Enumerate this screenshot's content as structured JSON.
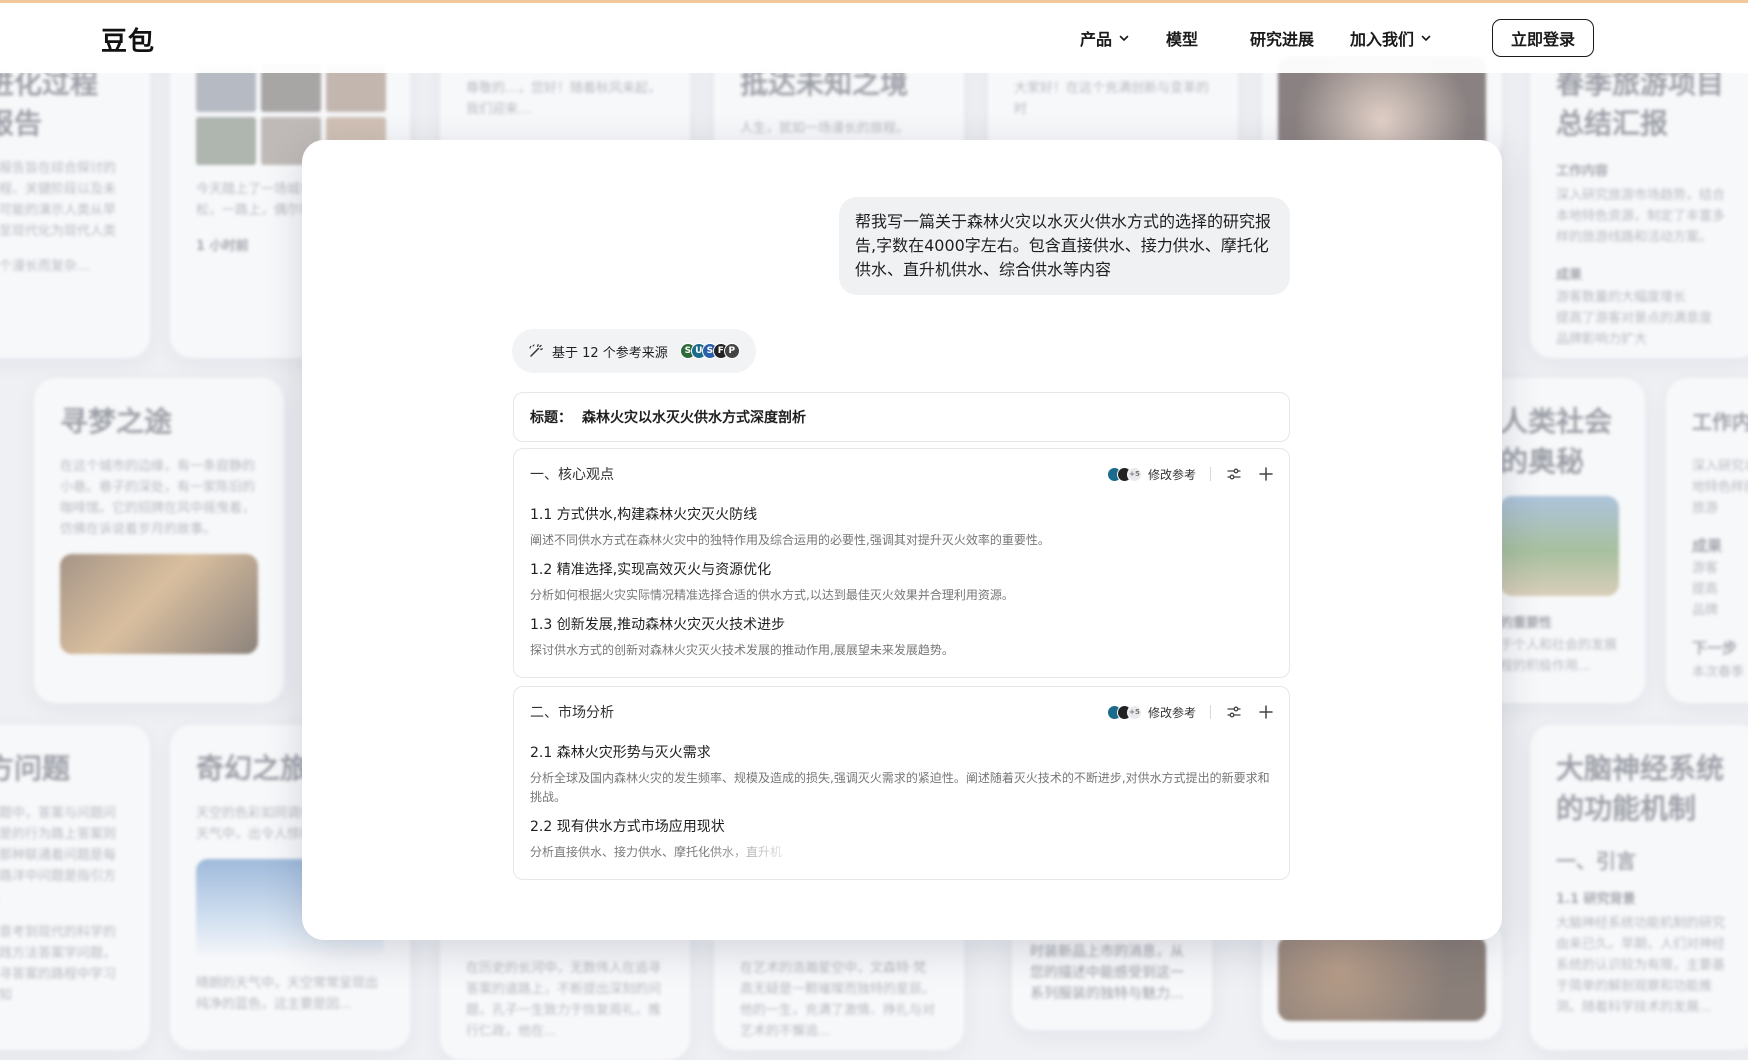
{
  "header": {
    "logo": "豆包",
    "nav": [
      {
        "label": "产品",
        "has_dropdown": true
      },
      {
        "label": "模型",
        "has_dropdown": false
      },
      {
        "label": "研究进展",
        "has_dropdown": false
      },
      {
        "label": "加入我们",
        "has_dropdown": true
      }
    ],
    "login_label": "立即登录"
  },
  "background_cards": [
    {
      "title": "进化过程\n报告",
      "text": "本报告旨在综合探讨的历程、关键阶段以及未来可能的演示人类从早期至现代化为现代人类",
      "footer": "一个漫长而复杂..."
    },
    {
      "text": "今天踏上了一场城市的喧嚣，轻松，一路上，偶尔轻拂脸颊",
      "meta": "1 小时前"
    },
    {
      "title": "寻梦之途",
      "text": "在这个城市的边缘，有一条寂静的小巷。巷子的深处，有一家陈旧的咖啡馆。它的招牌在风中摇曳着，仿佛在诉说着岁月的故事。"
    },
    {
      "title": "方问题",
      "text": "问题中，答案与问题问题是的行为路上答案则是那种联通着问题是每条路洋中问题是指引方向",
      "text2": "学意考到现代的科学的实践方法答案学问题，追寻答案的路程中学习求知"
    },
    {
      "title": "奇幻之旅",
      "text": "天空的色彩如同调色盘，在不同天气中，出令人惊叹的变化",
      "footer": "晴朗的天气中，天空常常呈现出纯净的蓝色，这主要是因..."
    },
    {
      "title": "抵达未知之境",
      "text": "人生，犹如一场漫长的旅程。"
    },
    {
      "text": "尊敬的…，您好！随着秋风来起，我们迎来…"
    },
    {
      "text": "在艺术的浩瀚星空中，文森特·梵高无疑是一颗璀璨而独特的星辰。他的一生，充满了激情、挣扎与对艺术的不懈追..."
    },
    {
      "text": "在历史的长河中，无数伟人在追寻答案的道路上，不断提出深刻的问题，孔子一生致力于恢复周礼，推行仁政，他在..."
    },
    {
      "text": "大家好！在这个充满创新与变革的时"
    },
    {
      "text": "时装新品上市的消息，从您的描述中能感受到这一系列服装的独特与魅力..."
    },
    {
      "title": "春季旅游项目\n总结汇报",
      "sub": "工作内容",
      "text": "深入研究旅游市场趋势，结合本地特色资源，制定了丰富多样的旅游线路和活动方案。",
      "sub2": "成果",
      "bullets": [
        "游客数量的大幅度增长",
        "提高了游客对景点的满意度",
        "品牌影响力扩大"
      ]
    },
    {
      "title": "人类社会\n的奥秘",
      "sub": "的重要性",
      "text": "于个人和社会的发展程的积极作用..."
    },
    {
      "title": "工作内",
      "text": "深入研究本地特色样的旅游",
      "sub": "成果",
      "bullets": [
        "游客",
        "提高",
        "品牌"
      ],
      "sub2": "下一步",
      "text2": "本次春季"
    },
    {
      "title": "大脑神经系统\n的功能机制",
      "sub": "一、引言",
      "meta": "1.1 研究背景",
      "text": "大脑神经系统功能机制的研究由来已久。早期，人们对神经系统的认识较为有限，主要基于简单的解剖观察和功能推测。随着科学技术的发展..."
    }
  ],
  "chat": {
    "user_message": "帮我写一篇关于森林火灾以水灭火供水方式的选择的研究报告,字数在4000字左右。包含直接供水、接力供水、摩托化供水、直升机供水、综合供水等内容",
    "sources_label": "基于 12 个参考来源",
    "source_icons": [
      {
        "glyph": "S",
        "color": "#2f6b3a"
      },
      {
        "glyph": "U",
        "color": "#1b6c8c"
      },
      {
        "glyph": "S",
        "color": "#2b5fa8"
      },
      {
        "glyph": "F",
        "color": "#222222"
      },
      {
        "glyph": "P",
        "color": "#444444"
      }
    ],
    "outline": {
      "title_label": "标题：",
      "title_value": "森林火灾以水灭火供水方式深度剖析",
      "ref_edit_label": "修改参考",
      "ref_more": "+5",
      "sections": [
        {
          "heading": "一、核心观点",
          "items": [
            {
              "title": "1.1 方式供水,构建森林火灾灭火防线",
              "desc": "阐述不同供水方式在森林火灾中的独特作用及综合运用的必要性,强调其对提升灭火效率的重要性。"
            },
            {
              "title": "1.2 精准选择,实现高效灭火与资源优化",
              "desc": "分析如何根据火灾实际情况精准选择合适的供水方式,以达到最佳灭火效果并合理利用资源。"
            },
            {
              "title": "1.3 创新发展,推动森林火灾灭火技术进步",
              "desc": "探讨供水方式的创新对森林火灾灭火技术发展的推动作用,展展望未来发展趋势。"
            }
          ]
        },
        {
          "heading": "二、市场分析",
          "items": [
            {
              "title": "2.1 森林火灾形势与灭火需求",
              "desc": "分析全球及国内森林火灾的发生频率、规模及造成的损失,强调灭火需求的紧迫性。阐述随着灭火技术的不断进步,对供水方式提出的新要求和挑战。"
            },
            {
              "title": "2.2 现有供水方式市场应用现状",
              "desc": "分析直接供水、接力供水、摩托化供水，直升机"
            }
          ]
        }
      ]
    }
  },
  "colors": {
    "accent_border": "#1a1a1a",
    "top_strip": "#f2c79a",
    "bubble_bg": "#f0f1f3",
    "page_bg": "#eef0f4"
  }
}
